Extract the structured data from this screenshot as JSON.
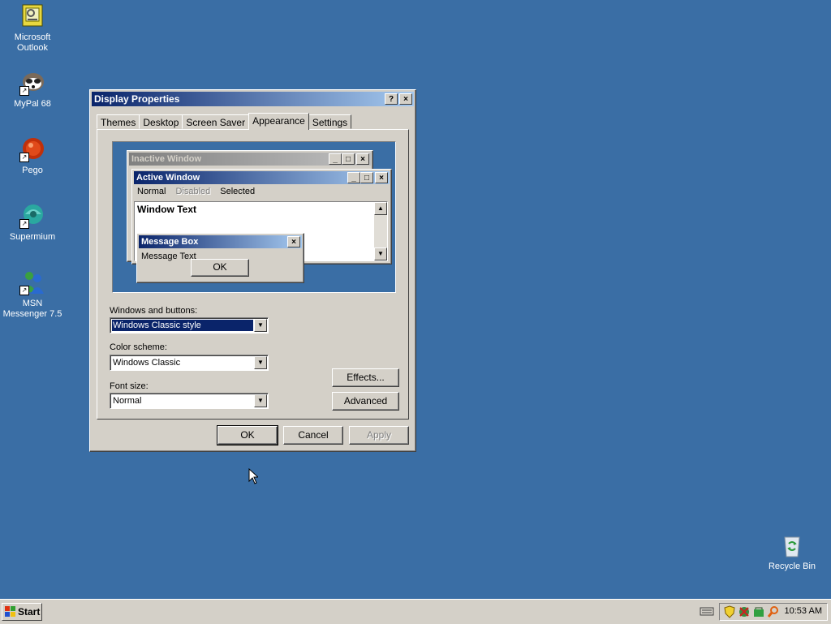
{
  "desktop": {
    "background_color": "#3a6ea5",
    "icons": [
      {
        "label_line1": "Microsoft",
        "label_line2": "Outlook",
        "icon": "outlook-icon"
      },
      {
        "label_line1": "MyPal 68",
        "label_line2": "",
        "icon": "raccoon-icon"
      },
      {
        "label_line1": "Pego",
        "label_line2": "",
        "icon": "pego-icon"
      },
      {
        "label_line1": "Supermium",
        "label_line2": "",
        "icon": "supermium-icon"
      },
      {
        "label_line1": "MSN",
        "label_line2": "Messenger 7.5",
        "icon": "msn-messenger-icon"
      },
      {
        "label_line1": "Recycle Bin",
        "label_line2": "",
        "icon": "recycle-bin-icon"
      }
    ]
  },
  "dialog": {
    "title": "Display Properties",
    "help_button": "?",
    "close_button": "×",
    "tabs": [
      {
        "label": "Themes",
        "active": false
      },
      {
        "label": "Desktop",
        "active": false
      },
      {
        "label": "Screen Saver",
        "active": false
      },
      {
        "label": "Appearance",
        "active": true
      },
      {
        "label": "Settings",
        "active": false
      }
    ],
    "preview": {
      "inactive_title": "Inactive Window",
      "active_title": "Active Window",
      "menu_normal": "Normal",
      "menu_disabled": "Disabled",
      "menu_selected": "Selected",
      "window_text": "Window Text",
      "message_box_title": "Message Box",
      "message_text": "Message Text",
      "ok": "OK"
    },
    "windows_buttons_label": "Windows and buttons:",
    "windows_buttons_value": "Windows Classic style",
    "color_scheme_label": "Color scheme:",
    "color_scheme_value": "Windows Classic",
    "font_size_label": "Font size:",
    "font_size_value": "Normal",
    "effects_button": "Effects...",
    "advanced_button": "Advanced",
    "ok_button": "OK",
    "cancel_button": "Cancel",
    "apply_button": "Apply"
  },
  "taskbar": {
    "start_label": "Start",
    "clock": "10:53 AM"
  }
}
